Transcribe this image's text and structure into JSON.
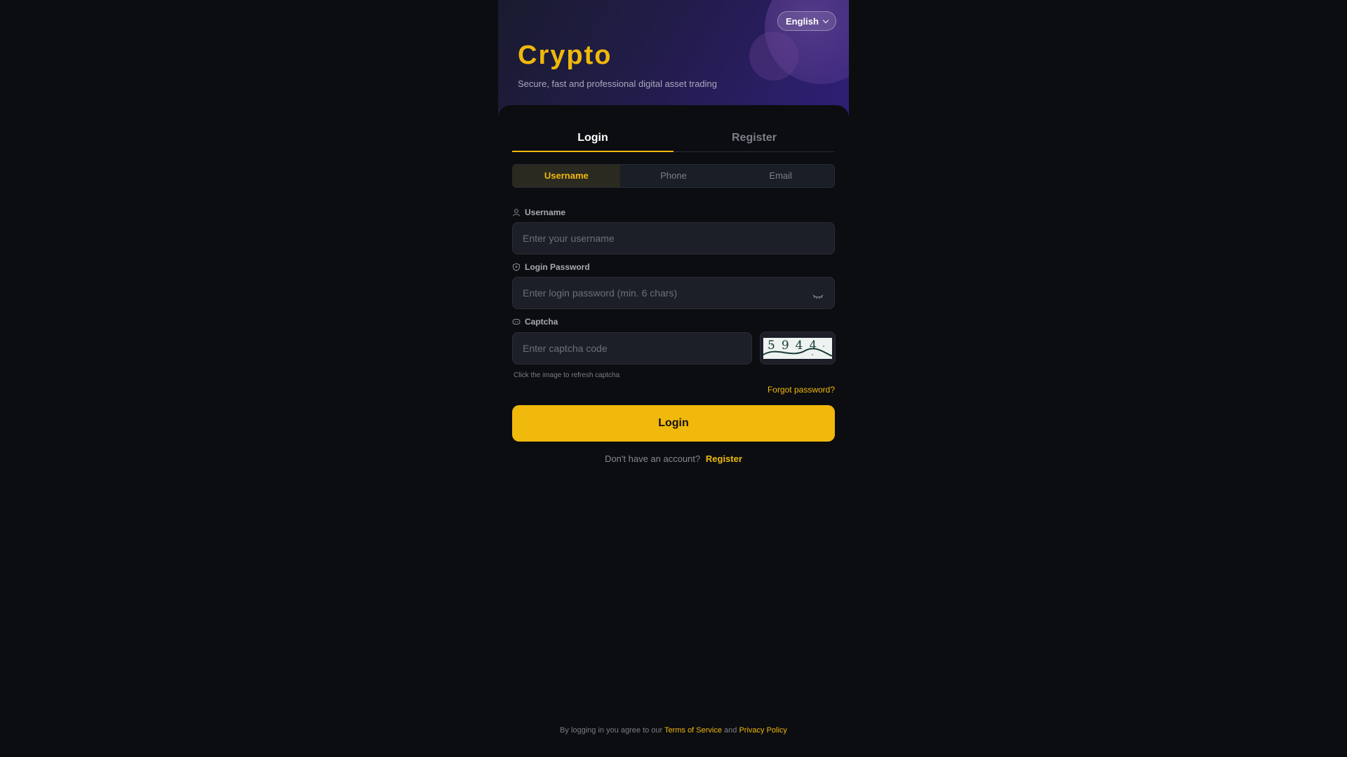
{
  "header": {
    "language": "English",
    "brand_title": "Crypto",
    "brand_subtitle": "Secure, fast and professional digital asset trading"
  },
  "tabs": [
    {
      "label": "Login",
      "active": true
    },
    {
      "label": "Register",
      "active": false
    }
  ],
  "method_tabs": [
    {
      "label": "Username",
      "active": true
    },
    {
      "label": "Phone",
      "active": false
    },
    {
      "label": "Email",
      "active": false
    }
  ],
  "form": {
    "username_label": "Username",
    "username_placeholder": "Enter your username",
    "password_label": "Login Password",
    "password_placeholder": "Enter login password (min. 6 chars)",
    "captcha_label": "Captcha",
    "captcha_placeholder": "Enter captcha code",
    "captcha_code": "5944",
    "captcha_hint": "Click the image to refresh captcha",
    "forgot_password": "Forgot password?",
    "submit_label": "Login"
  },
  "signup": {
    "prompt": "Don't have an account?",
    "link": "Register"
  },
  "footer": {
    "prefix": "By logging in you agree to our",
    "terms": "Terms of Service",
    "and": "and",
    "privacy": "Privacy Policy"
  },
  "colors": {
    "accent": "#f0b90b",
    "background": "#0c0d11",
    "input_bg": "#1c1f27"
  },
  "icons": [
    "chevron-down-icon",
    "user-icon",
    "shield-icon",
    "captcha-icon",
    "eye-closed-icon"
  ]
}
